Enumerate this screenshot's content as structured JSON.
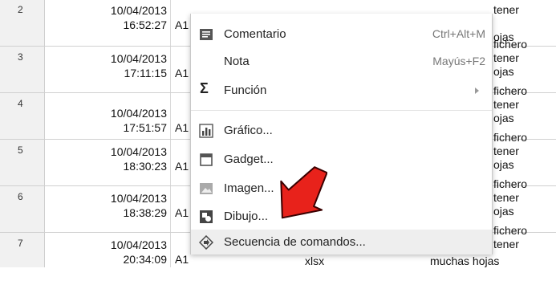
{
  "rows": [
    {
      "num": "2",
      "date": "10/04/2013",
      "time": "16:52:27",
      "col": "A1",
      "r1": "tener",
      "r2": "ojas",
      "r0": ""
    },
    {
      "num": "3",
      "date": "10/04/2013",
      "time": "17:11:15",
      "col": "A1",
      "r0": "fichero",
      "r1": "tener",
      "r2": "ojas"
    },
    {
      "num": "4",
      "date": "10/04/2013",
      "time": "17:51:57",
      "col": "A1",
      "r0": "fichero",
      "r1": "tener",
      "r2": "ojas"
    },
    {
      "num": "5",
      "date": "10/04/2013",
      "time": "18:30:23",
      "col": "A1",
      "r0": "fichero",
      "r1": "tener",
      "r2": "ojas"
    },
    {
      "num": "6",
      "date": "10/04/2013",
      "time": "18:38:29",
      "col": "A1",
      "r0": "fichero",
      "r1": "tener",
      "r2": "ojas"
    },
    {
      "num": "7",
      "date": "10/04/2013",
      "time": "20:34:09",
      "col": "A1",
      "r0": "fichero",
      "r1": "tener",
      "r2": "ojas"
    }
  ],
  "partial_bottom": {
    "xlsx": "xlsx",
    "hojas": "muchas hojas"
  },
  "menu": {
    "items": [
      {
        "label": "Comentario",
        "shortcut": "Ctrl+Alt+M",
        "icon": "comment-icon"
      },
      {
        "label": "Nota",
        "shortcut": "Mayús+F2",
        "icon": ""
      },
      {
        "label": "Función",
        "shortcut": "",
        "icon": "sigma-icon",
        "submenu": true
      },
      {
        "label": "Gráfico...",
        "shortcut": "",
        "icon": "chart-icon"
      },
      {
        "label": "Gadget...",
        "shortcut": "",
        "icon": "gadget-icon"
      },
      {
        "label": "Imagen...",
        "shortcut": "",
        "icon": "image-icon"
      },
      {
        "label": "Dibujo...",
        "shortcut": "",
        "icon": "drawing-icon"
      },
      {
        "label": "Secuencia de comandos...",
        "shortcut": "",
        "icon": "script-icon"
      }
    ]
  },
  "colors": {
    "annotation": "#e8221b",
    "highlight": "#eeeeee"
  }
}
